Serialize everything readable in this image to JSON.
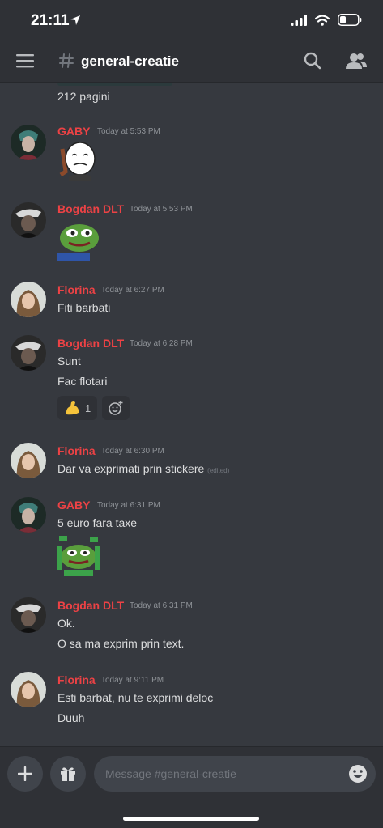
{
  "status_bar": {
    "time": "21:11"
  },
  "header": {
    "channel_name": "general-creatie"
  },
  "previous": {
    "text": "212 pagini"
  },
  "messages": [
    {
      "author": "GABY",
      "timestamp": "Today at 5:53 PM",
      "lines": []
    },
    {
      "author": "Bogdan DLT",
      "timestamp": "Today at 5:53 PM",
      "lines": []
    },
    {
      "author": "Florina",
      "timestamp": "Today at 6:27 PM",
      "lines": [
        "Fiti barbati"
      ]
    },
    {
      "author": "Bogdan DLT",
      "timestamp": "Today at 6:28 PM",
      "lines": [
        "Sunt",
        "Fac flotari"
      ],
      "reactions": [
        {
          "emoji": "flexed-biceps",
          "count": "1"
        }
      ]
    },
    {
      "author": "Florina",
      "timestamp": "Today at 6:30 PM",
      "lines": [
        "Dar va exprimati prin stickere"
      ],
      "edited_label": "(edited)"
    },
    {
      "author": "GABY",
      "timestamp": "Today at 6:31 PM",
      "lines": [
        "5 euro fara taxe"
      ]
    },
    {
      "author": "Bogdan DLT",
      "timestamp": "Today at 6:31 PM",
      "lines": [
        "Ok.",
        "O sa ma exprim prin text."
      ]
    },
    {
      "author": "Florina",
      "timestamp": "Today at 9:11 PM",
      "lines": [
        "Esti barbat, nu te exprimi deloc",
        "Duuh"
      ]
    }
  ],
  "composer": {
    "placeholder": "Message #general-creatie"
  },
  "colors": {
    "author": "#ed4245",
    "background": "#36393f",
    "header": "#2f3136"
  }
}
